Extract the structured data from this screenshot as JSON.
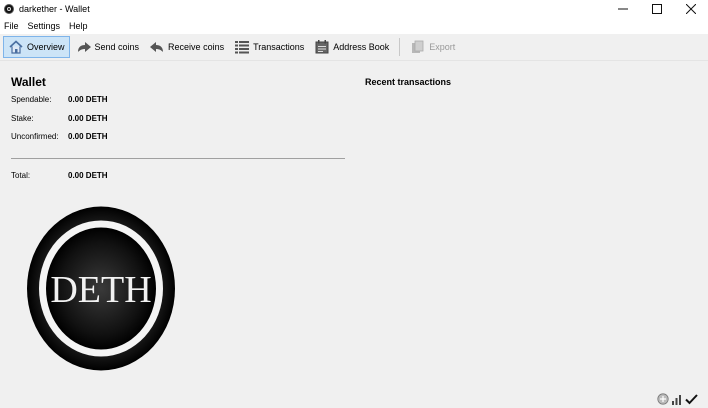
{
  "window": {
    "title": "darkether - Wallet",
    "minimize_glyph": "—",
    "maximize_glyph": "☐",
    "close_glyph": "✕"
  },
  "menu": {
    "items": [
      "File",
      "Settings",
      "Help"
    ]
  },
  "toolbar": {
    "overview": "Overview",
    "send": "Send coins",
    "receive": "Receive coins",
    "transactions": "Transactions",
    "address_book": "Address Book",
    "export": "Export"
  },
  "wallet": {
    "title": "Wallet",
    "spendable_label": "Spendable:",
    "spendable_value": "0.00 DETH",
    "stake_label": "Stake:",
    "stake_value": "0.00 DETH",
    "unconfirmed_label": "Unconfirmed:",
    "unconfirmed_value": "0.00 DETH",
    "total_label": "Total:",
    "total_value": "0.00 DETH"
  },
  "recent": {
    "title": "Recent transactions"
  },
  "logo": {
    "text": "DETH"
  },
  "colors": {
    "active_tab_bg": "#cce4f7",
    "active_tab_border": "#7eb4ea",
    "window_bg": "#f0f0f0",
    "icon_blue": "#5b7fb0"
  },
  "icons": {
    "app": "darkether-coin-icon",
    "overview": "home-icon",
    "send": "arrow-forward-icon",
    "receive": "arrow-back-icon",
    "transactions": "list-icon",
    "address_book": "address-book-icon",
    "export": "export-icon",
    "network": "network-icon",
    "signal": "signal-bars-icon",
    "synced": "check-icon"
  }
}
